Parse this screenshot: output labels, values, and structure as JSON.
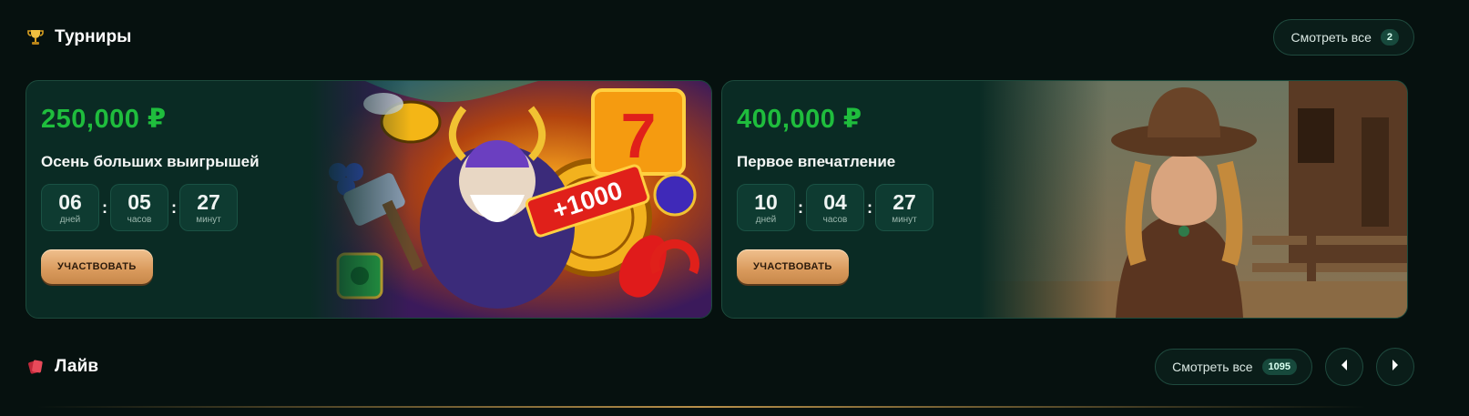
{
  "tournaments_section": {
    "title": "Турниры",
    "icon": "trophy-icon",
    "see_all_label": "Смотреть все",
    "see_all_count": "2"
  },
  "cards": [
    {
      "prize": "250,000 ₽",
      "name": "Осень больших выигрышей",
      "timer": [
        {
          "value": "06",
          "label": "дней"
        },
        {
          "value": "05",
          "label": "часов"
        },
        {
          "value": "27",
          "label": "минут"
        }
      ],
      "join_label": "УЧАСТВОВАТЬ",
      "art": "viking-slots-illustration"
    },
    {
      "prize": "400,000 ₽",
      "name": "Первое впечатление",
      "timer": [
        {
          "value": "10",
          "label": "дней"
        },
        {
          "value": "04",
          "label": "часов"
        },
        {
          "value": "27",
          "label": "минут"
        }
      ],
      "join_label": "УЧАСТВОВАТЬ",
      "art": "cowgirl-western-photo"
    }
  ],
  "live_section": {
    "title": "Лайв",
    "icon": "cards-icon",
    "see_all_label": "Смотреть все",
    "see_all_count": "1095",
    "prev_icon": "chevron-left-icon",
    "next_icon": "chevron-right-icon"
  },
  "colors": {
    "background": "#06110f",
    "card": "#0a2b24",
    "prize_green": "#1fbd3d",
    "button_gold": "#d99a5c"
  }
}
